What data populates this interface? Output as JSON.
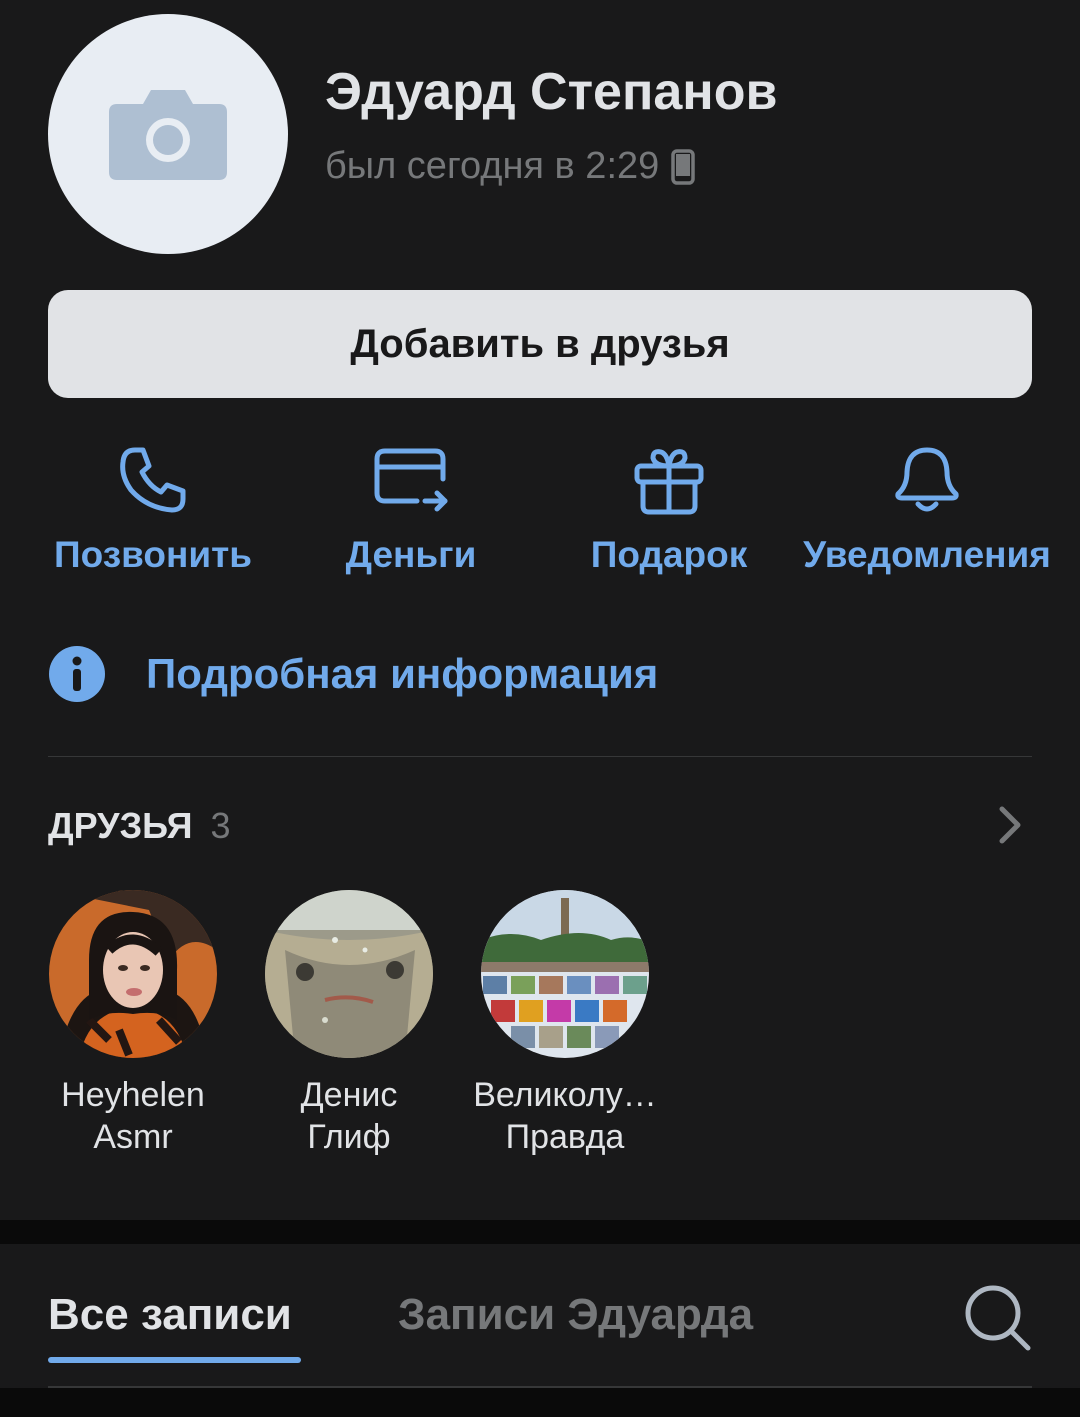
{
  "profile": {
    "name": "Эдуард Степанов",
    "status": "был сегодня в 2:29",
    "status_icon": "phone-icon"
  },
  "add_friend_label": "Добавить в друзья",
  "actions": [
    {
      "label": "Позвонить",
      "icon": "phone-call-icon"
    },
    {
      "label": "Деньги",
      "icon": "card-transfer-icon"
    },
    {
      "label": "Подарок",
      "icon": "gift-icon"
    },
    {
      "label": "Уведомления",
      "icon": "bell-icon"
    }
  ],
  "info": {
    "label": "Подробная информация",
    "icon": "info-icon"
  },
  "friends": {
    "title": "ДРУЗЬЯ",
    "count": "3",
    "items": [
      {
        "name_line1": "Heyhelen",
        "name_line2": "Asmr"
      },
      {
        "name_line1": "Денис",
        "name_line2": "Глиф"
      },
      {
        "name_line1": "Великолу…",
        "name_line2": "Правда"
      }
    ]
  },
  "tabs": {
    "active": "Все записи",
    "inactive": "Записи Эдуарда"
  },
  "colors": {
    "accent": "#71aaeb",
    "background": "#19191a",
    "text": "#e1e3e6",
    "secondary": "#76787a"
  }
}
